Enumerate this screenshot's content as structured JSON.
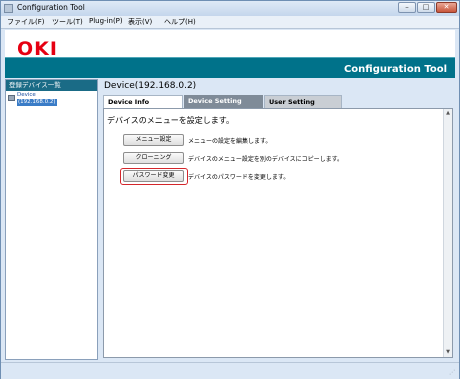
{
  "window": {
    "title": "Configuration Tool",
    "min": "–",
    "max": "□",
    "close": "✕"
  },
  "menu": [
    "ファイル(F)",
    "ツール(T)",
    "Plug-in(P)",
    "表示(V)",
    "ヘルプ(H)"
  ],
  "banner": {
    "logo": "OKI",
    "title": "Configuration Tool",
    "accent_color": "#00728a",
    "logo_color": "#e60012"
  },
  "sidebar": {
    "header": "登録デバイス一覧",
    "device": {
      "name": "Device",
      "ip": "(192.168.0.2)",
      "icon": "printer-icon"
    }
  },
  "main": {
    "device_title": "Device(192.168.0.2)",
    "tabs": [
      {
        "label": "Device Info",
        "active": false
      },
      {
        "label": "Device Setting",
        "active": true
      },
      {
        "label": "User Setting",
        "active": false
      }
    ],
    "heading": "デバイスのメニューを設定します。",
    "actions": [
      {
        "button": "メニュー設定",
        "description": "メニューの設定を編集します。"
      },
      {
        "button": "クローニング",
        "description": "デバイスのメニュー設定を別のデバイスにコピーします。"
      },
      {
        "button": "パスワード変更",
        "description": "デバイスのパスワードを変更します。",
        "highlighted": true
      }
    ]
  },
  "scroll": {
    "up": "▲",
    "down": "▼"
  },
  "status": {
    "grip": "⋰"
  }
}
